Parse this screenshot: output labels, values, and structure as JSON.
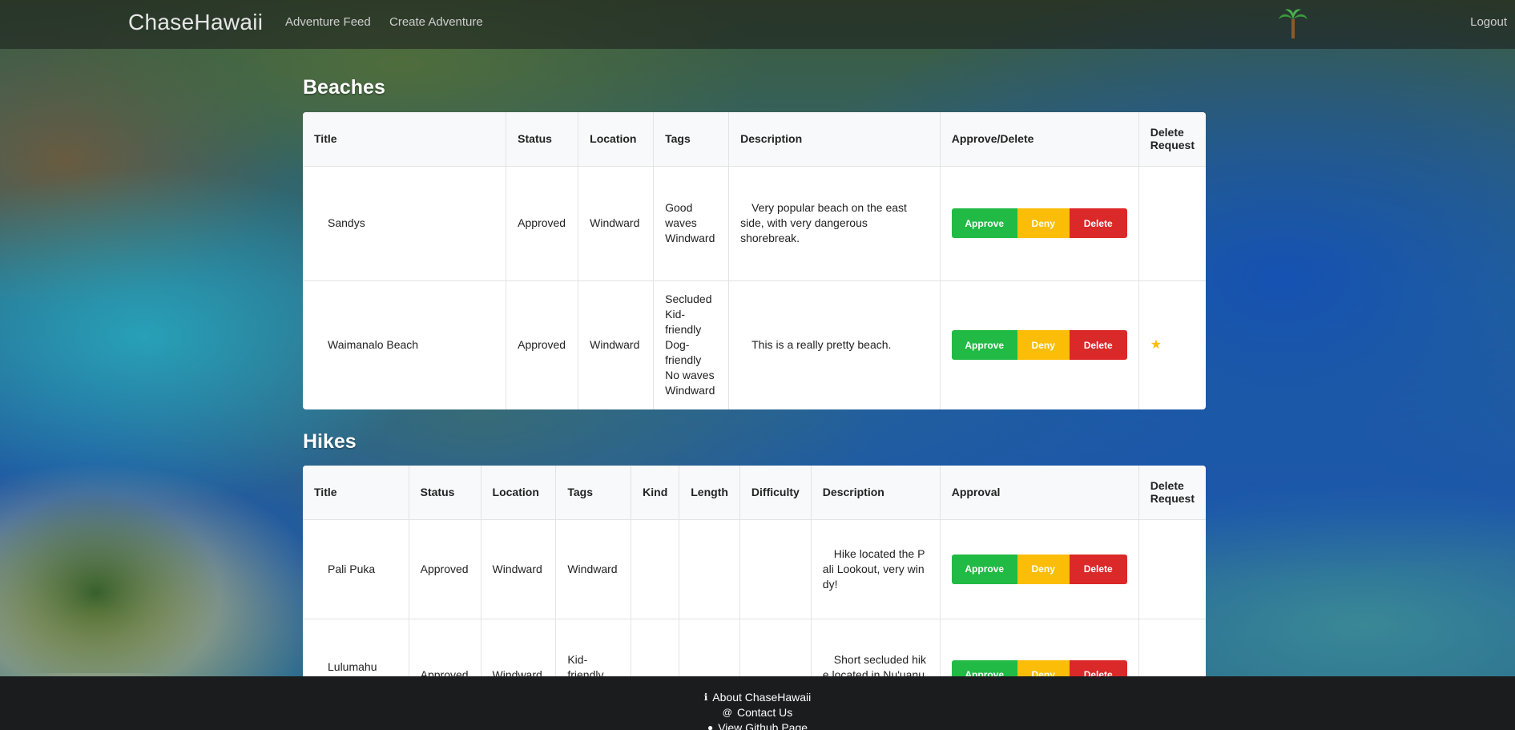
{
  "navbar": {
    "brand": "ChaseHawaii",
    "links": [
      "Adventure Feed",
      "Create Adventure"
    ],
    "logout": "Logout",
    "logo_icon": "palm-tree-icon"
  },
  "beaches": {
    "title": "Beaches",
    "columns": [
      "Title",
      "Status",
      "Location",
      "Tags",
      "Description",
      "Approve/Delete",
      "Delete Request"
    ],
    "rows": [
      {
        "title": "Sandys",
        "status": "Approved",
        "location": "Windward",
        "tags": "Good waves Windward",
        "description": "Very popular beach on the east side, with very dangerous shorebreak.",
        "delete_request": false
      },
      {
        "title": "Waimanalo Beach",
        "status": "Approved",
        "location": "Windward",
        "tags": "Secluded Kid-friendly Dog-friendly No waves Windward",
        "description": "This is a really pretty beach.",
        "delete_request": true
      }
    ]
  },
  "hikes": {
    "title": "Hikes",
    "columns": [
      "Title",
      "Status",
      "Location",
      "Tags",
      "Kind",
      "Length",
      "Difficulty",
      "Description",
      "Approval",
      "Delete Request"
    ],
    "rows": [
      {
        "title": "Pali Puka",
        "status": "Approved",
        "location": "Windward",
        "tags": "Windward",
        "kind": "",
        "length": "",
        "difficulty": "",
        "description": "Hike located the Pali Lookout, very windy!"
      },
      {
        "title": "Lulumahu Fall",
        "status": "Approved",
        "location": "Windward",
        "tags": "Kid-friendly Dog-",
        "kind": "",
        "length": "",
        "difficulty": "",
        "description": "Short secluded hike located in Nu'uanu v"
      }
    ]
  },
  "buttons": {
    "approve": "Approve",
    "deny": "Deny",
    "delete": "Delete"
  },
  "footer": {
    "about": "About ChaseHawaii",
    "contact": "Contact Us",
    "github": "View Github Page"
  },
  "colors": {
    "approve": "#21ba45",
    "deny": "#fbbd08",
    "delete": "#db2828",
    "footer_bg": "#1b1c1d"
  }
}
